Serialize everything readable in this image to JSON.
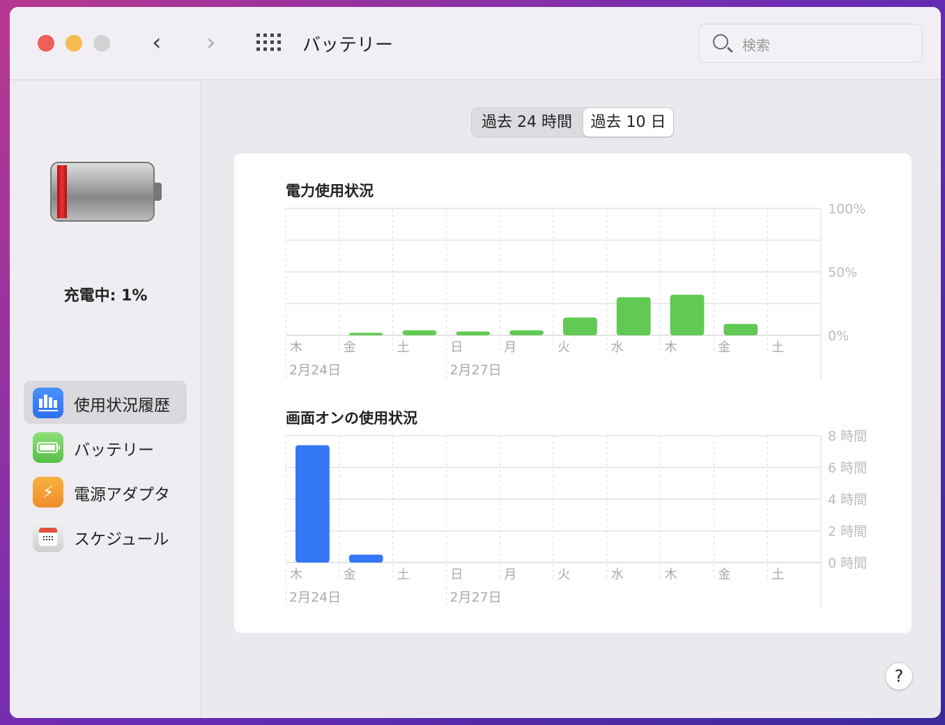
{
  "window": {
    "title": "バッテリー",
    "search_placeholder": "検索"
  },
  "sidebar": {
    "status": "充電中: 1%",
    "battery_level_percent": 1,
    "items": [
      {
        "label": "使用状況履歴",
        "icon": "bar-chart-icon",
        "selected": true
      },
      {
        "label": "バッテリー",
        "icon": "battery-icon"
      },
      {
        "label": "電源アダプタ",
        "icon": "bolt-icon"
      },
      {
        "label": "スケジュール",
        "icon": "calendar-icon"
      }
    ]
  },
  "segments": [
    {
      "label": "過去 24 時間",
      "selected": false
    },
    {
      "label": "過去 10 日",
      "selected": true
    }
  ],
  "help": "?",
  "chart_data": [
    {
      "type": "bar",
      "title": "電力使用状況",
      "categories": [
        "木",
        "金",
        "土",
        "日",
        "月",
        "火",
        "水",
        "木",
        "金",
        "土"
      ],
      "date_labels": [
        "2月24日",
        "2月27日"
      ],
      "values": [
        0,
        2,
        4,
        3,
        4,
        14,
        30,
        32,
        9,
        0
      ],
      "yticks": [
        "100%",
        "50%",
        "0%"
      ],
      "ylim": [
        0,
        100
      ],
      "color": "#62c955"
    },
    {
      "type": "bar",
      "title": "画面オンの使用状況",
      "categories": [
        "木",
        "金",
        "土",
        "日",
        "月",
        "火",
        "水",
        "木",
        "金",
        "土"
      ],
      "date_labels": [
        "2月24日",
        "2月27日"
      ],
      "values": [
        7.4,
        0.5,
        0,
        0,
        0,
        0,
        0,
        0,
        0,
        0
      ],
      "yticks": [
        "8 時間",
        "6 時間",
        "4 時間",
        "2 時間",
        "0 時間"
      ],
      "ylim": [
        0,
        8
      ],
      "color": "#3478f6"
    }
  ]
}
